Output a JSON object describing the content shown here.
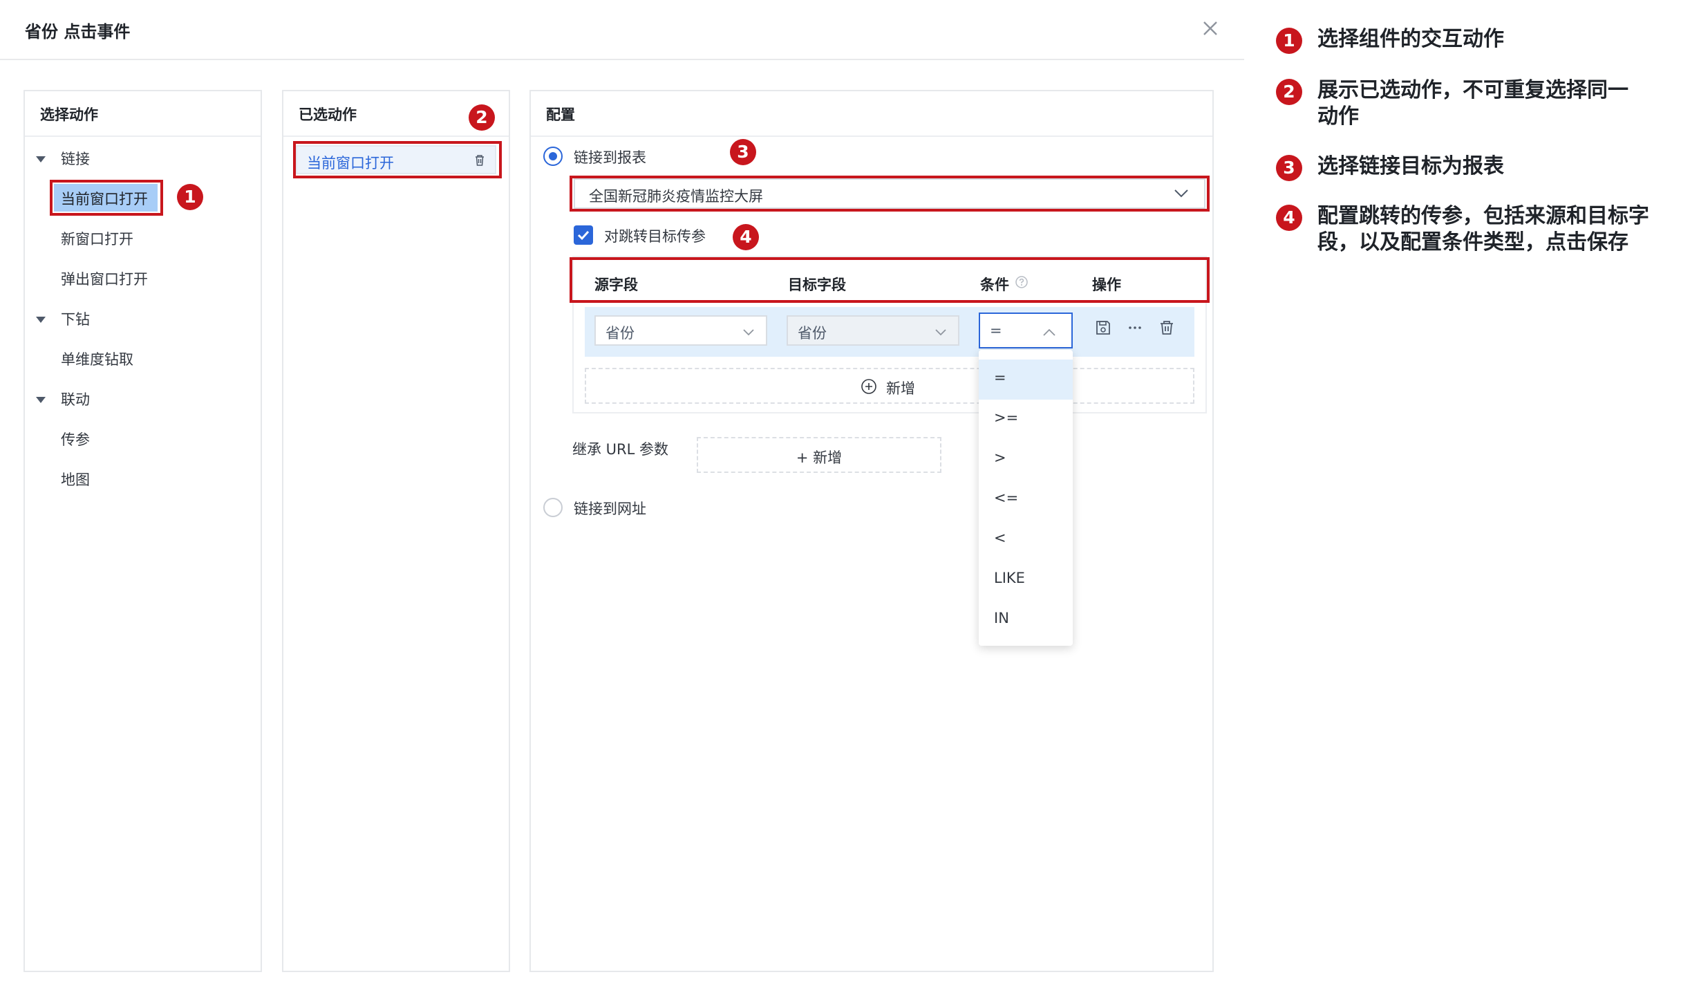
{
  "dialog": {
    "title": "省份 点击事件",
    "close_label": "关闭"
  },
  "panel_actions": {
    "title": "选择动作",
    "groups": [
      {
        "label": "链接",
        "children": [
          "当前窗口打开",
          "新窗口打开",
          "弹出窗口打开"
        ]
      },
      {
        "label": "下钻",
        "children": [
          "单维度钻取"
        ]
      },
      {
        "label": "联动",
        "children": [
          "传参",
          "地图"
        ]
      }
    ],
    "selected": "当前窗口打开"
  },
  "panel_selected": {
    "title": "已选动作",
    "item": "当前窗口打开"
  },
  "panel_config": {
    "title": "配置",
    "link_report_label": "链接到报表",
    "report_value": "全国新冠肺炎疫情监控大屏",
    "pass_param_label": "对跳转目标传参",
    "columns": [
      "源字段",
      "目标字段",
      "条件",
      "操作"
    ],
    "row": {
      "source": "省份",
      "target": "省份",
      "condition": "="
    },
    "add_label": "新增",
    "inherit_url_label": "继承 URL 参数",
    "inherit_add_label": "+ 新增",
    "link_url_label": "链接到网址",
    "condition_options": [
      "=",
      ">=",
      ">",
      "<=",
      "<",
      "LIKE",
      "IN"
    ]
  },
  "badges": [
    "1",
    "2",
    "3",
    "4"
  ],
  "legend": [
    {
      "num": "1",
      "lines": [
        "选择组件的交互动作"
      ]
    },
    {
      "num": "2",
      "lines": [
        "展示已选动作，不可重复选择同一",
        "动作"
      ]
    },
    {
      "num": "3",
      "lines": [
        "选择链接目标为报表"
      ]
    },
    {
      "num": "4",
      "lines": [
        "配置跳转的传参，包括来源和目标字",
        "段，以及配置条件类型，点击保存"
      ]
    }
  ],
  "colors": {
    "accent": "#2b66d9",
    "highlight": "#c8161d",
    "selected_bg": "#a8cdf7",
    "row_bg": "#e1effc"
  }
}
